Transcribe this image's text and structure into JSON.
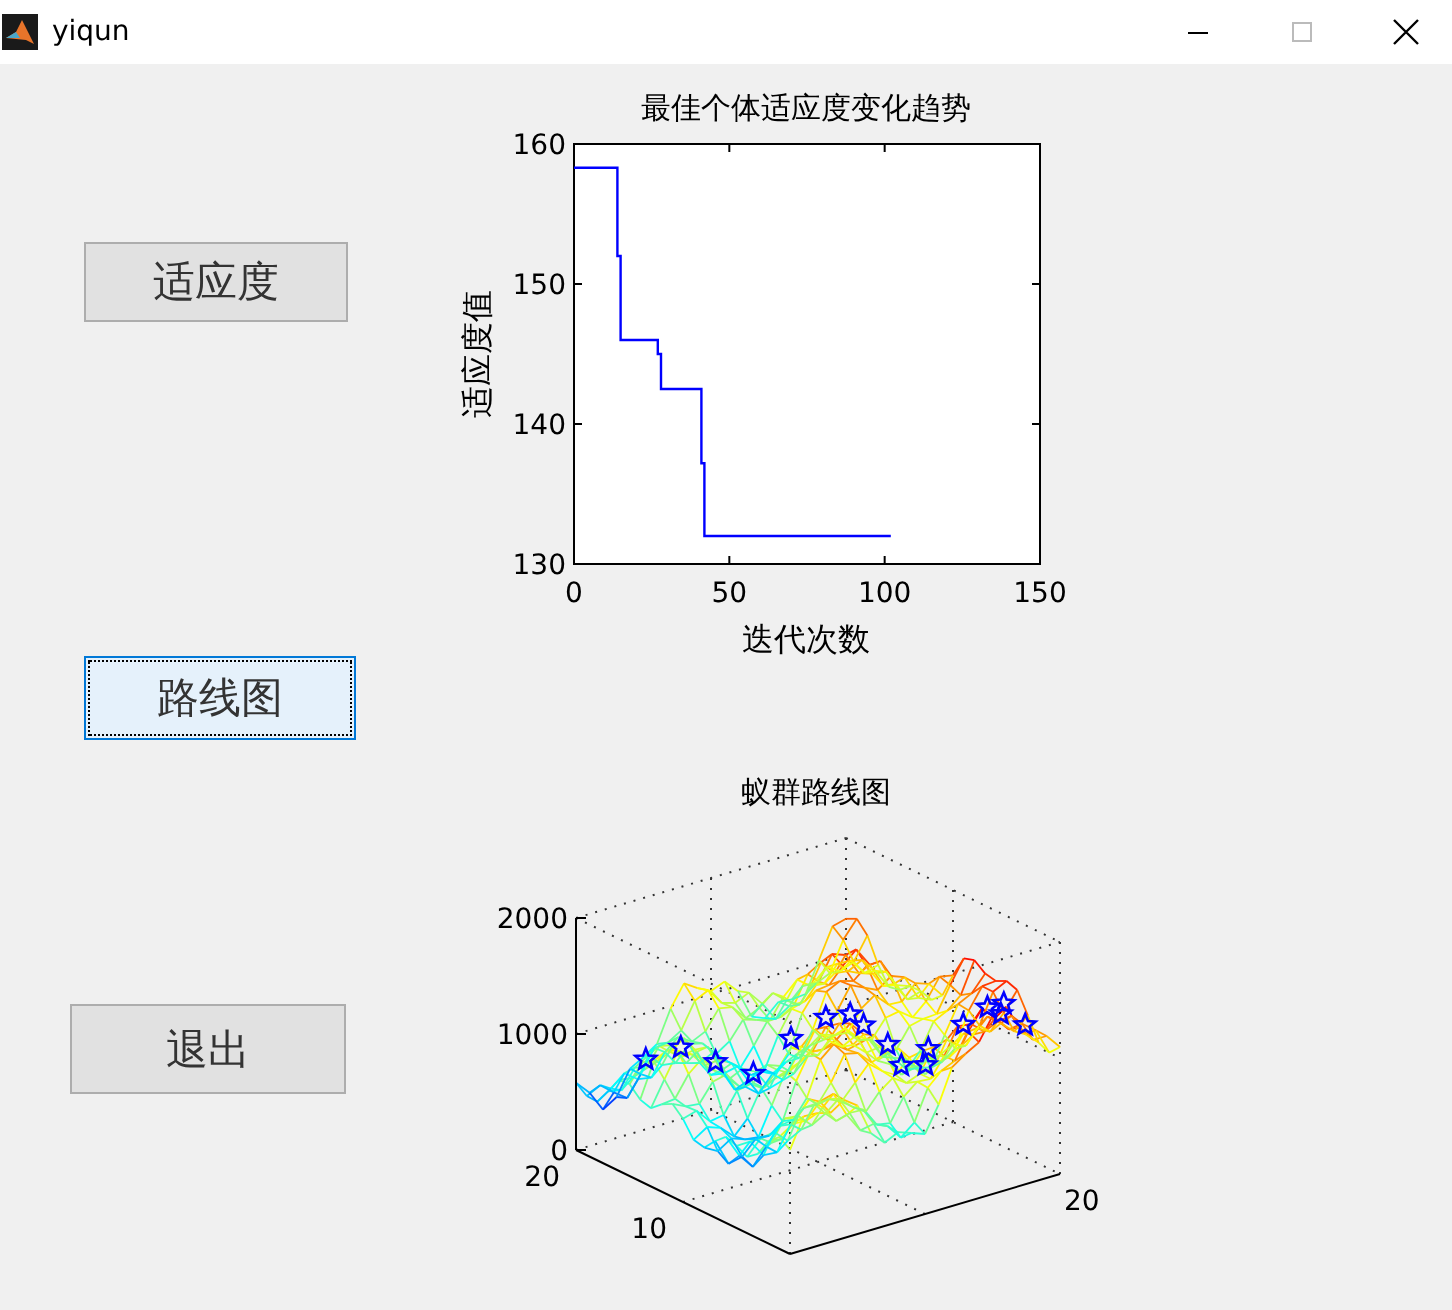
{
  "window": {
    "title": "yiqun"
  },
  "buttons": [
    {
      "label": "适应度",
      "focused": false
    },
    {
      "label": "路线图",
      "focused": true
    },
    {
      "label": "退出",
      "focused": false
    }
  ],
  "fitness_plot": {
    "chart_data": {
      "type": "line",
      "title": "最佳个体适应度变化趋势",
      "xlabel": "迭代次数",
      "ylabel": "适应度值",
      "xlim": [
        0,
        150
      ],
      "ylim": [
        130,
        160
      ],
      "xticks": [
        0,
        50,
        100,
        150
      ],
      "yticks": [
        130,
        140,
        150,
        160
      ],
      "x": [
        0,
        14,
        14,
        15,
        15,
        27,
        27,
        28,
        28,
        41,
        41,
        42,
        42,
        102
      ],
      "series": [
        {
          "color": "#0000ff",
          "values": [
            158.3,
            158.3,
            152,
            152,
            146,
            146,
            145,
            145,
            142.5,
            142.5,
            137.2,
            137.2,
            132,
            132
          ]
        }
      ]
    }
  },
  "route_plot": {
    "title": "蚁群路线图",
    "z_ticks": [
      "2000",
      "1000",
      "0"
    ],
    "y_ticks": [
      "20",
      "10"
    ],
    "x_ticks": [
      "20"
    ]
  }
}
